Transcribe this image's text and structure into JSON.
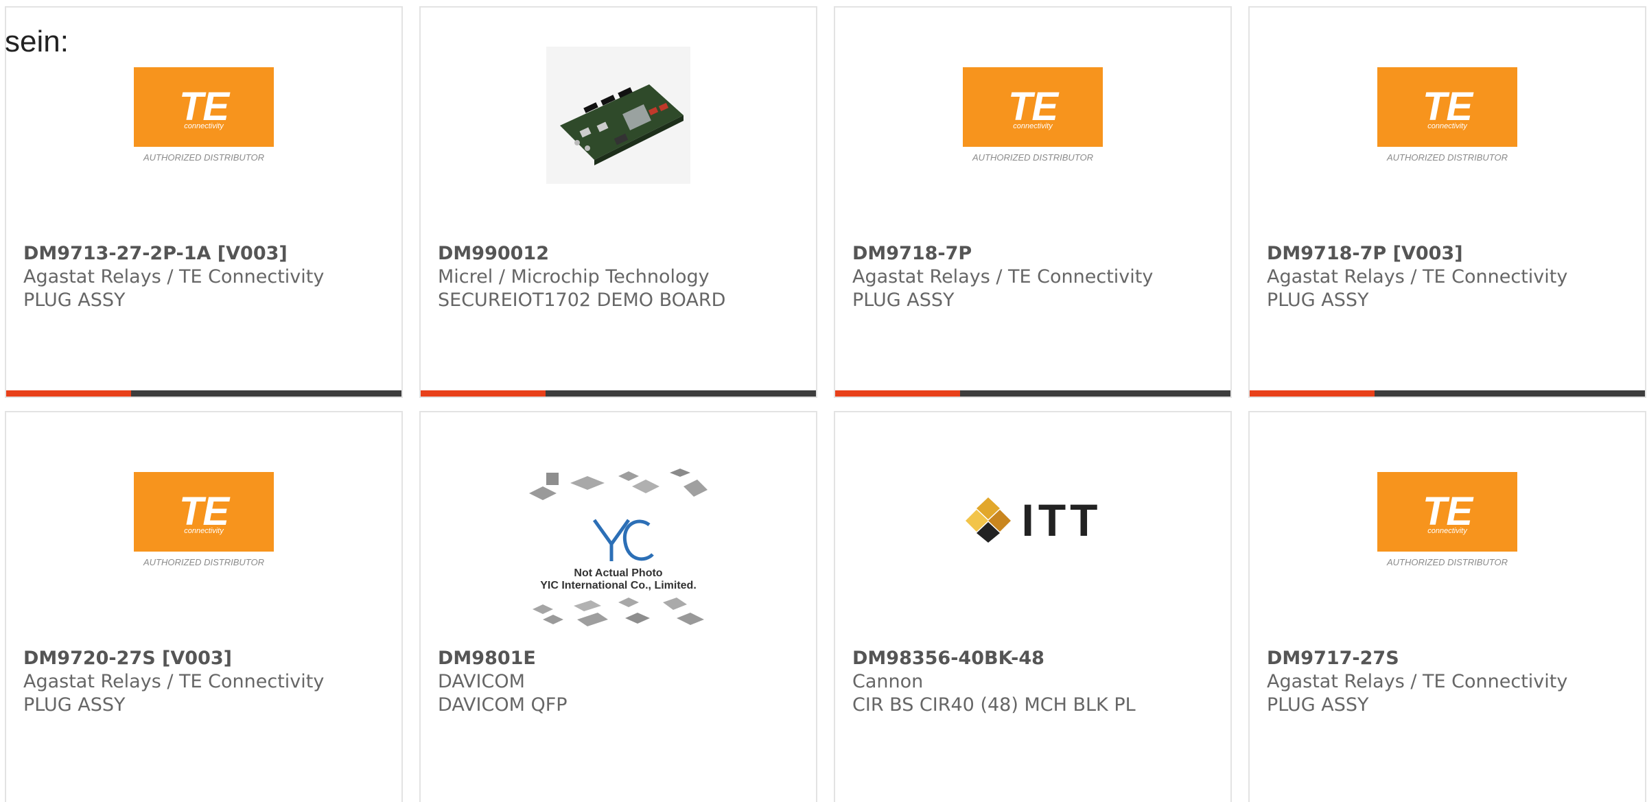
{
  "intro_text": "sein:",
  "colors": {
    "accent_bar": "#e8401a",
    "bar_base": "#3d3d3d",
    "te_orange": "#f7941d"
  },
  "products": [
    {
      "part_number": "DM9713-27-2P-1A [V003]",
      "manufacturer": "Agastat Relays / TE Connectivity",
      "description": "PLUG ASSY",
      "image": "te-logo"
    },
    {
      "part_number": "DM990012",
      "manufacturer": "Micrel / Microchip Technology",
      "description": "SECUREIOT1702 DEMO BOARD",
      "image": "circuit-board-photo"
    },
    {
      "part_number": "DM9718-7P",
      "manufacturer": "Agastat Relays / TE Connectivity",
      "description": "PLUG ASSY",
      "image": "te-logo"
    },
    {
      "part_number": "DM9718-7P [V003]",
      "manufacturer": "Agastat Relays / TE Connectivity",
      "description": "PLUG ASSY",
      "image": "te-logo"
    },
    {
      "part_number": "DM9720-27S [V003]",
      "manufacturer": "Agastat Relays / TE Connectivity",
      "description": "PLUG ASSY",
      "image": "te-logo"
    },
    {
      "part_number": "DM9801E",
      "manufacturer": "DAVICOM",
      "description": "DAVICOM QFP",
      "image": "yic-placeholder"
    },
    {
      "part_number": "DM98356-40BK-48",
      "manufacturer": "Cannon",
      "description": "CIR BS CIR40 (48) MCH BLK PL",
      "image": "itt-logo"
    },
    {
      "part_number": "DM9717-27S",
      "manufacturer": "Agastat Relays / TE Connectivity",
      "description": "PLUG ASSY",
      "image": "te-logo"
    }
  ],
  "logos": {
    "te": {
      "word": "TE",
      "sub": "connectivity",
      "dist": "AUTHORIZED DISTRIBUTOR"
    },
    "itt": {
      "word": "ITT"
    },
    "yic": {
      "line1": "Not Actual Photo",
      "line2": "YIC International Co., Limited."
    }
  }
}
